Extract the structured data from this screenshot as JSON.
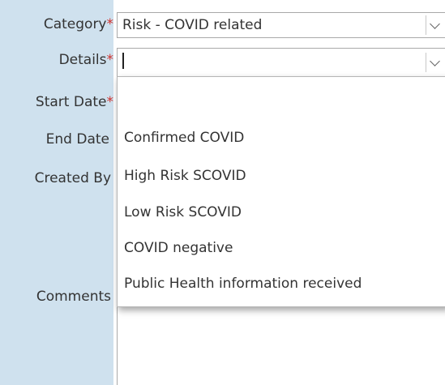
{
  "form": {
    "labels": {
      "category": "Category",
      "details": "Details",
      "start_date": "Start Date",
      "end_date": "End Date",
      "created_by": "Created By",
      "comments": "Comments"
    },
    "required_mark": "*",
    "category_value": "Risk - COVID related",
    "details_value": ""
  },
  "dropdown": {
    "options": [
      "Confirmed COVID",
      "High Risk SCOVID",
      "Low Risk SCOVID",
      "COVID negative",
      "Public Health information received"
    ]
  },
  "icons": {
    "category_caret": "chevron-down-icon",
    "details_caret": "chevron-down-icon"
  },
  "colors": {
    "label_panel": "#cfe1ee",
    "required": "#d0312d",
    "text": "#333333"
  }
}
